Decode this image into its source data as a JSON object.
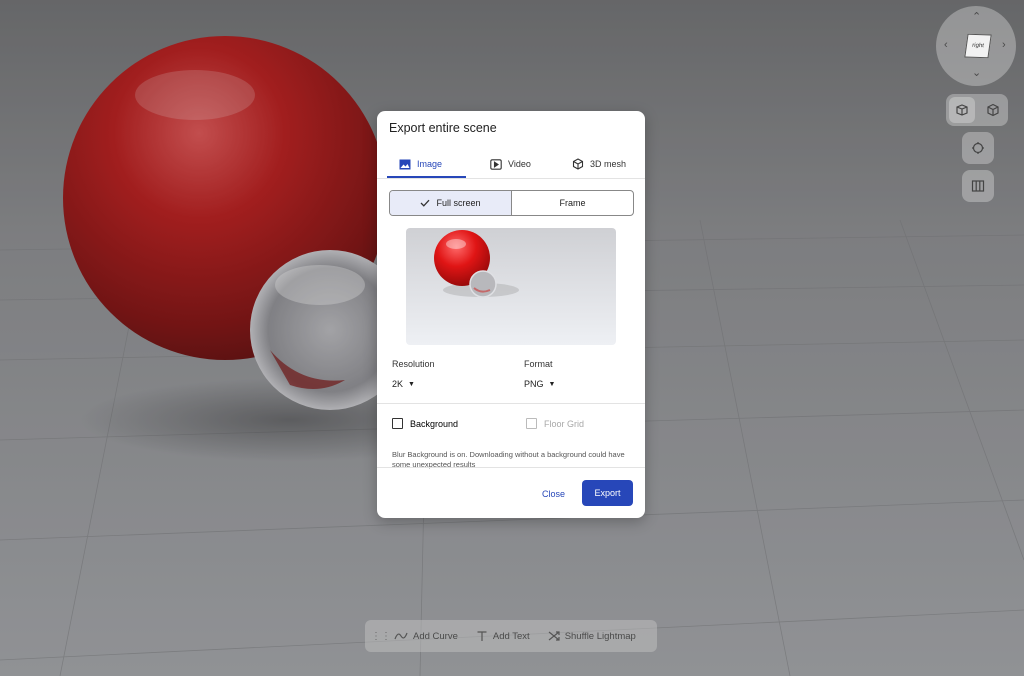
{
  "dialog": {
    "title": "Export entire scene",
    "tabs": [
      {
        "label": "Image",
        "icon": "image-icon",
        "active": true
      },
      {
        "label": "Video",
        "icon": "video-icon",
        "active": false
      },
      {
        "label": "3D mesh",
        "icon": "cube-icon",
        "active": false
      }
    ],
    "mode": {
      "full_screen": "Full screen",
      "frame": "Frame",
      "selected": "Full screen"
    },
    "resolution": {
      "label": "Resolution",
      "value": "2K"
    },
    "format": {
      "label": "Format",
      "value": "PNG"
    },
    "background": {
      "label": "Background",
      "checked": false
    },
    "floor_grid": {
      "label": "Floor Grid",
      "checked": false,
      "disabled": true
    },
    "note": "Blur Background is on. Downloading without a background could have some unexpected results",
    "close_label": "Close",
    "export_label": "Export",
    "accent_color": "#2747b9"
  },
  "navcube": {
    "face_label": "right"
  },
  "toolbar": {
    "add_curve": "Add Curve",
    "add_text": "Add Text",
    "shuffle_lightmap": "Shuffle Lightmap"
  }
}
